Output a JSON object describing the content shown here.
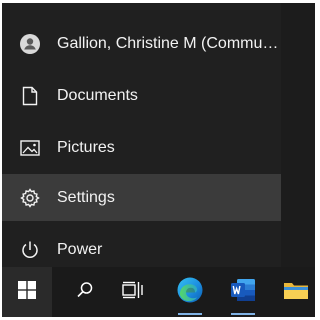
{
  "start_menu": {
    "items": [
      {
        "label": "Gallion, Christine M (Commu…",
        "icon": "user-avatar-icon"
      },
      {
        "label": "Documents",
        "icon": "document-icon"
      },
      {
        "label": "Pictures",
        "icon": "picture-icon"
      },
      {
        "label": "Settings",
        "icon": "gear-icon",
        "state": "hover"
      },
      {
        "label": "Power",
        "icon": "power-icon"
      }
    ]
  },
  "taskbar": {
    "buttons": [
      {
        "icon": "windows-logo-icon"
      },
      {
        "icon": "search-icon"
      },
      {
        "icon": "task-view-icon"
      },
      {
        "icon": "edge-browser-icon"
      },
      {
        "icon": "word-icon"
      },
      {
        "icon": "file-explorer-icon"
      }
    ]
  },
  "colors": {
    "menu_bg": "#202020",
    "hover_bg": "#3b3b3b",
    "taskbar_bg": "#1a1a1a",
    "text": "#f2f2f2",
    "active_underline": "#7fb2e5"
  }
}
